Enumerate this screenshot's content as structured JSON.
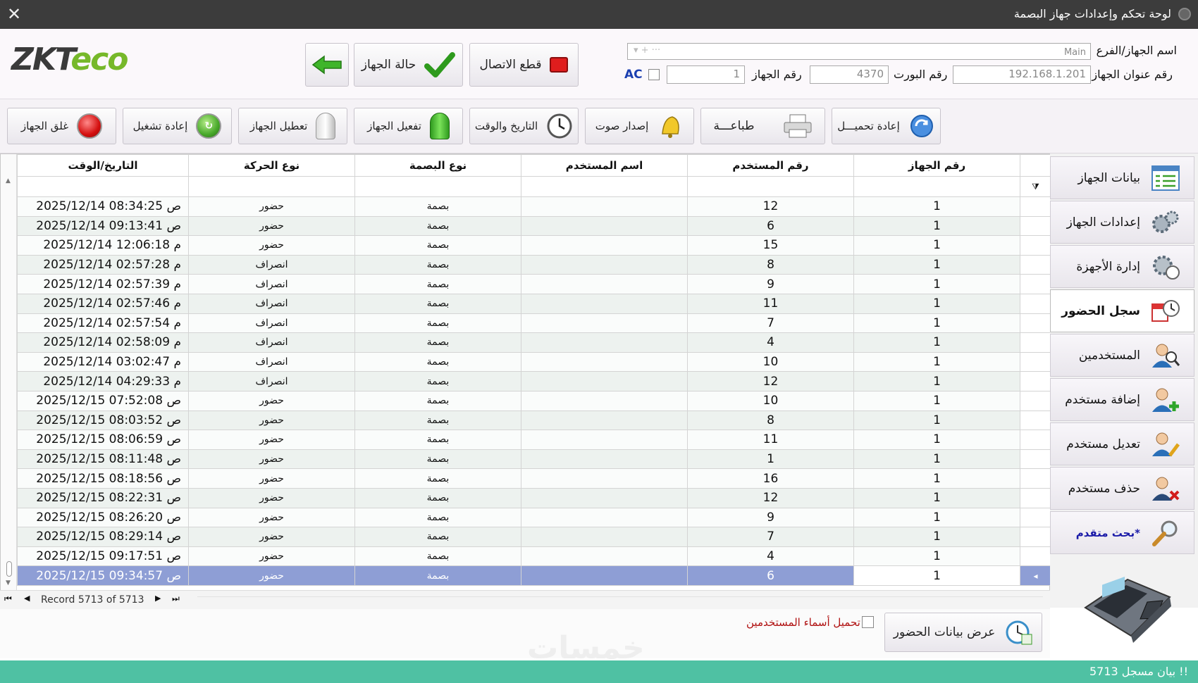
{
  "window": {
    "title": "لوحة تحكم وإعدادات جهاز البصمة",
    "close": "✕"
  },
  "logo": {
    "text_zk": "ZKT",
    "text_eco": "eco"
  },
  "header": {
    "back_label": "",
    "status_label": "حالة الجهاز",
    "disconnect_label": "قطع الاتصال",
    "device_name_label": "اسم الجهاز/الفرع",
    "device_name_value": "Main",
    "ip_label": "رقم عنوان الجهاز",
    "ip_value": "192.168.1.201",
    "port_label": "رقم البورت",
    "port_value": "4370",
    "device_no_label": "رقم الجهاز",
    "device_no_value": "1",
    "ac_label": "AC"
  },
  "toolbar": {
    "shutdown": "غلق الجهاز",
    "restart": "إعادة تشغيل",
    "disable": "تعطيل الجهاز",
    "enable": "تفعيل الجهاز",
    "datetime": "التاريخ والوقت",
    "sound": "إصدار صوت",
    "print": "طباعـــة",
    "reload": "إعادة تحميـــل"
  },
  "grid": {
    "columns": [
      "التاريخ/الوقت",
      "نوع الحركة",
      "نوع البصمة",
      "اسم المستخدم",
      "رقم المستخدم",
      "رقم الجهاز"
    ],
    "rows": [
      [
        "2025/12/14 08:34:25 ص",
        "حضور",
        "بصمة",
        "",
        "12",
        "1"
      ],
      [
        "2025/12/14 09:13:41 ص",
        "حضور",
        "بصمة",
        "",
        "6",
        "1"
      ],
      [
        "2025/12/14 12:06:18 م",
        "حضور",
        "بصمة",
        "",
        "15",
        "1"
      ],
      [
        "2025/12/14 02:57:28 م",
        "انصراف",
        "بصمة",
        "",
        "8",
        "1"
      ],
      [
        "2025/12/14 02:57:39 م",
        "انصراف",
        "بصمة",
        "",
        "9",
        "1"
      ],
      [
        "2025/12/14 02:57:46 م",
        "انصراف",
        "بصمة",
        "",
        "11",
        "1"
      ],
      [
        "2025/12/14 02:57:54 م",
        "انصراف",
        "بصمة",
        "",
        "7",
        "1"
      ],
      [
        "2025/12/14 02:58:09 م",
        "انصراف",
        "بصمة",
        "",
        "4",
        "1"
      ],
      [
        "2025/12/14 03:02:47 م",
        "انصراف",
        "بصمة",
        "",
        "10",
        "1"
      ],
      [
        "2025/12/14 04:29:33 م",
        "انصراف",
        "بصمة",
        "",
        "12",
        "1"
      ],
      [
        "2025/12/15 07:52:08 ص",
        "حضور",
        "بصمة",
        "",
        "10",
        "1"
      ],
      [
        "2025/12/15 08:03:52 ص",
        "حضور",
        "بصمة",
        "",
        "8",
        "1"
      ],
      [
        "2025/12/15 08:06:59 ص",
        "حضور",
        "بصمة",
        "",
        "11",
        "1"
      ],
      [
        "2025/12/15 08:11:48 ص",
        "حضور",
        "بصمة",
        "",
        "1",
        "1"
      ],
      [
        "2025/12/15 08:18:56 ص",
        "حضور",
        "بصمة",
        "",
        "16",
        "1"
      ],
      [
        "2025/12/15 08:22:31 ص",
        "حضور",
        "بصمة",
        "",
        "12",
        "1"
      ],
      [
        "2025/12/15 08:26:20 ص",
        "حضور",
        "بصمة",
        "",
        "9",
        "1"
      ],
      [
        "2025/12/15 08:29:14 ص",
        "حضور",
        "بصمة",
        "",
        "7",
        "1"
      ],
      [
        "2025/12/15 09:17:51 ص",
        "حضور",
        "بصمة",
        "",
        "4",
        "1"
      ],
      [
        "2025/12/15 09:34:57 ص",
        "حضور",
        "بصمة",
        "",
        "6",
        "1"
      ]
    ],
    "selected_row": 19,
    "record_text": "Record 5713 of 5713"
  },
  "sidenav": {
    "items": [
      {
        "label": "بيانات الجهاز"
      },
      {
        "label": "إعدادات الجهاز"
      },
      {
        "label": "إدارة الأجهزة"
      },
      {
        "label": "سجل الحضور"
      },
      {
        "label": "المستخدمين"
      },
      {
        "label": "إضافة مستخدم"
      },
      {
        "label": "تعديل مستخدم"
      },
      {
        "label": "حذف مستخدم"
      },
      {
        "label": "بحث متقدم*"
      }
    ],
    "active_index": 3
  },
  "footer": {
    "show_attendance": "عرض بيانات الحضور",
    "load_names": "تحميل أسماء المستخدمين"
  },
  "status": {
    "text": "5713 بيان مسجل !!"
  },
  "colors": {
    "titlebar": "#3c3c3c",
    "status": "#4fc1a3",
    "selected_row": "#8e9ed5",
    "advanced_search": "#1a1aa8",
    "load_names": "#b01010"
  }
}
